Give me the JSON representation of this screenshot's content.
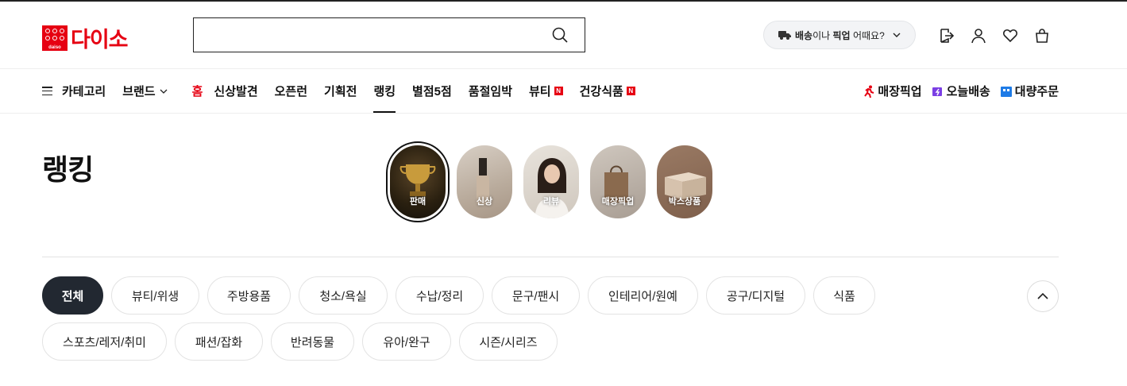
{
  "header": {
    "logo_text": "다이소",
    "logo_mini": "daiso",
    "search_placeholder": "",
    "delivery": {
      "bold1": "배송",
      "mid": "이나 ",
      "bold2": "픽업",
      "tail": " 어때요?"
    },
    "icons": [
      "logout-icon",
      "user-icon",
      "heart-icon",
      "bag-icon"
    ]
  },
  "nav": {
    "category": "카테고리",
    "brand": "브랜드",
    "items": [
      "홈",
      "신상발견",
      "오픈런",
      "기획전",
      "랭킹",
      "별점5점",
      "품절임박",
      "뷰티",
      "건강식품"
    ],
    "new_badge": "N",
    "services": [
      "매장픽업",
      "오늘배송",
      "대량주문"
    ]
  },
  "page": {
    "title": "랭킹",
    "ranking_types": [
      "판매",
      "신상",
      "리뷰",
      "매장픽업",
      "박스상품"
    ]
  },
  "categories": {
    "row1": [
      "전체",
      "뷰티/위생",
      "주방용품",
      "청소/욕실",
      "수납/정리",
      "문구/팬시",
      "인테리어/원예",
      "공구/디지털",
      "식품"
    ],
    "row2": [
      "스포츠/레저/취미",
      "패션/잡화",
      "반려동물",
      "유아/완구",
      "시즌/시리즈"
    ]
  },
  "colors": {
    "brand_red": "#e60012",
    "chip_active": "#222831"
  }
}
